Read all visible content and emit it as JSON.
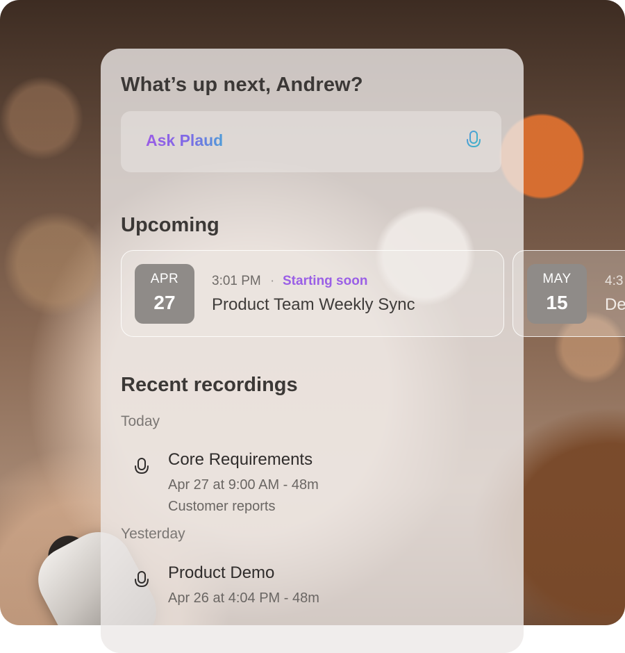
{
  "colors": {
    "accent_purple": "#9a5fe6",
    "ask_gradient_start": "#9b5de5",
    "ask_gradient_end": "#4f9cd8",
    "badge_gray": "#8f8b88",
    "heading_text": "#3b3836"
  },
  "greeting": "What’s up next, Andrew?",
  "ask": {
    "label": "Ask Plaud",
    "icon": "microphone-icon"
  },
  "upcoming": {
    "title": "Upcoming",
    "events": [
      {
        "month": "APR",
        "day": "27",
        "time": "3:01 PM",
        "separator": "·",
        "status": "Starting soon",
        "title": "Product Team Weekly Sync"
      },
      {
        "month": "MAY",
        "day": "15",
        "time": "4:3",
        "title": "De"
      }
    ]
  },
  "recent": {
    "title": "Recent recordings",
    "groups": [
      {
        "label": "Today",
        "items": [
          {
            "icon": "microphone-icon",
            "title": "Core Requirements",
            "meta": "Apr 27 at 9:00 AM - 48m",
            "folder": "Customer reports"
          }
        ]
      },
      {
        "label": "Yesterday",
        "items": [
          {
            "icon": "microphone-icon",
            "title": "Product Demo",
            "meta": "Apr 26 at 4:04 PM - 48m"
          }
        ]
      }
    ]
  }
}
